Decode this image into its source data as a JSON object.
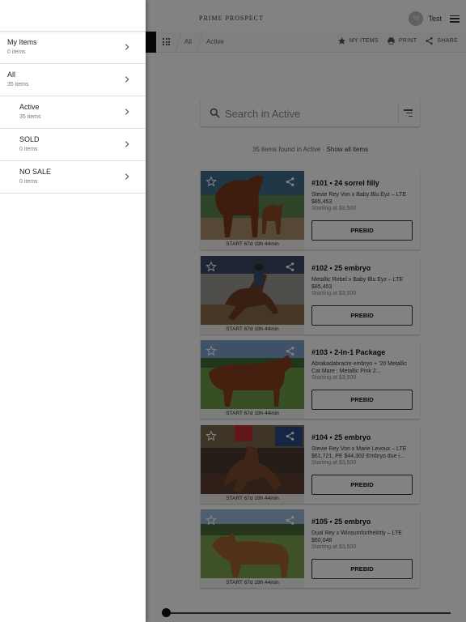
{
  "header": {
    "brand": "PRIME PROSPECT",
    "user_initials": "TE",
    "user_name": "Test"
  },
  "subbar": {
    "crumb_all": "All",
    "crumb_active": "Active",
    "my_items": "MY ITEMS",
    "print": "PRINT",
    "share": "SHARE"
  },
  "search": {
    "placeholder": "Search in Active"
  },
  "results": {
    "prefix": "35 items found in",
    "category": "Active",
    "separator": "·",
    "show_all": "Show all items"
  },
  "lots": [
    {
      "title": "#101 • 24 sorrel filly",
      "desc": "Stevie Rey Von x Baby Blu Eyz – LTE $85,453",
      "starting": "Starting at $3,500",
      "countdown": "START 67d 19h 44min",
      "button": "PREBID"
    },
    {
      "title": "#102 • 25 embryo",
      "desc": "Metallic Rebel x Baby Blu Eyz – LTE $85,453",
      "starting": "Starting at $3,500",
      "countdown": "START 67d 19h 44min",
      "button": "PREBID"
    },
    {
      "title": "#103 • 2-In-1 Package",
      "desc": "Abrakadabracre embryo + '20 Metallic Cat Mare : Metallic Pink 2...",
      "starting": "Starting at $3,500",
      "countdown": "START 67d 19h 44min",
      "button": "PREBID"
    },
    {
      "title": "#104 • 25 embryo",
      "desc": "Stevie Rey Von x Marie Levoux – LTE $61,721, PE $44,302 Embryo due i...",
      "starting": "Starting at $3,500",
      "countdown": "START 67d 19h 44min",
      "button": "PREBID"
    },
    {
      "title": "#105 • 25 embryo",
      "desc": "Dual Rey x Winsumforthekitty – LTE $60,048",
      "starting": "Starting at $3,500",
      "countdown": "START 67d 19h 44min",
      "button": "PREBID"
    }
  ],
  "drawer": {
    "items": [
      {
        "label": "My Items",
        "count": "0 items"
      },
      {
        "label": "All",
        "count": "35 items"
      },
      {
        "label": "Active",
        "count": "35 items"
      },
      {
        "label": "SOLD",
        "count": "0 items"
      },
      {
        "label": "NO SALE",
        "count": "0 items"
      }
    ]
  },
  "icons": {
    "star": "star-outline-icon",
    "share": "share-icon",
    "search": "search-icon",
    "sort": "sort-icon",
    "chevron": "chevron-right-icon",
    "menu": "hamburger-menu-icon",
    "grid": "grid-icon",
    "print": "print-icon"
  }
}
